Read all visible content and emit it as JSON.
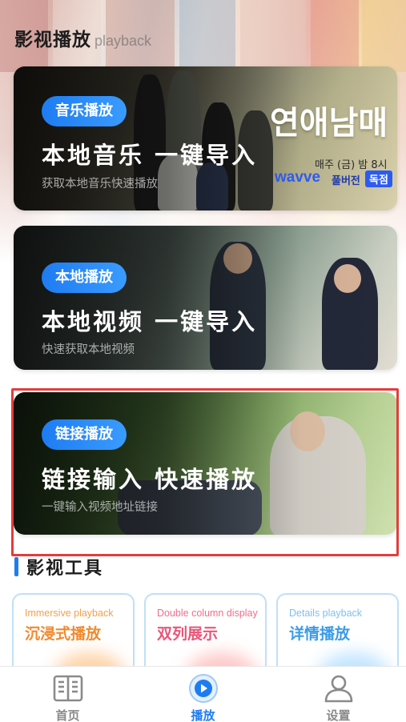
{
  "header": {
    "title": "影视播放",
    "subtitle": "playback"
  },
  "cards": [
    {
      "badge": "音乐播放",
      "title": "本地音乐 一键导入",
      "desc": "获取本地音乐快速播放",
      "poster_title": "연애남매",
      "poster_schedule": "매주 (금) 밤 8시",
      "poster_brand": "wavve",
      "poster_tag1": "풀버전",
      "poster_tag2": "독점"
    },
    {
      "badge": "本地播放",
      "title": "本地视频 一键导入",
      "desc": "快速获取本地视频"
    },
    {
      "badge": "链接播放",
      "title": "链接输入 快速播放",
      "desc": "一键输入视频地址链接"
    }
  ],
  "section": {
    "title": "影视工具"
  },
  "tools": [
    {
      "sub": "Immersive playback",
      "title": "沉浸式播放",
      "sub_color": "#f0a14a",
      "title_color": "#f08a2e"
    },
    {
      "sub": "Double column display",
      "title": "双列展示",
      "sub_color": "#ee6f8c",
      "title_color": "#e8567a"
    },
    {
      "sub": "Details playback",
      "title": "详情播放",
      "sub_color": "#7cc0ef",
      "title_color": "#3c9ce6"
    }
  ],
  "tabs": [
    {
      "label": "首页",
      "icon": "newspaper-icon"
    },
    {
      "label": "播放",
      "icon": "play-circle-icon"
    },
    {
      "label": "设置",
      "icon": "person-icon"
    }
  ],
  "colors": {
    "accent": "#1e7cf2",
    "highlight": "#e53c3c"
  }
}
